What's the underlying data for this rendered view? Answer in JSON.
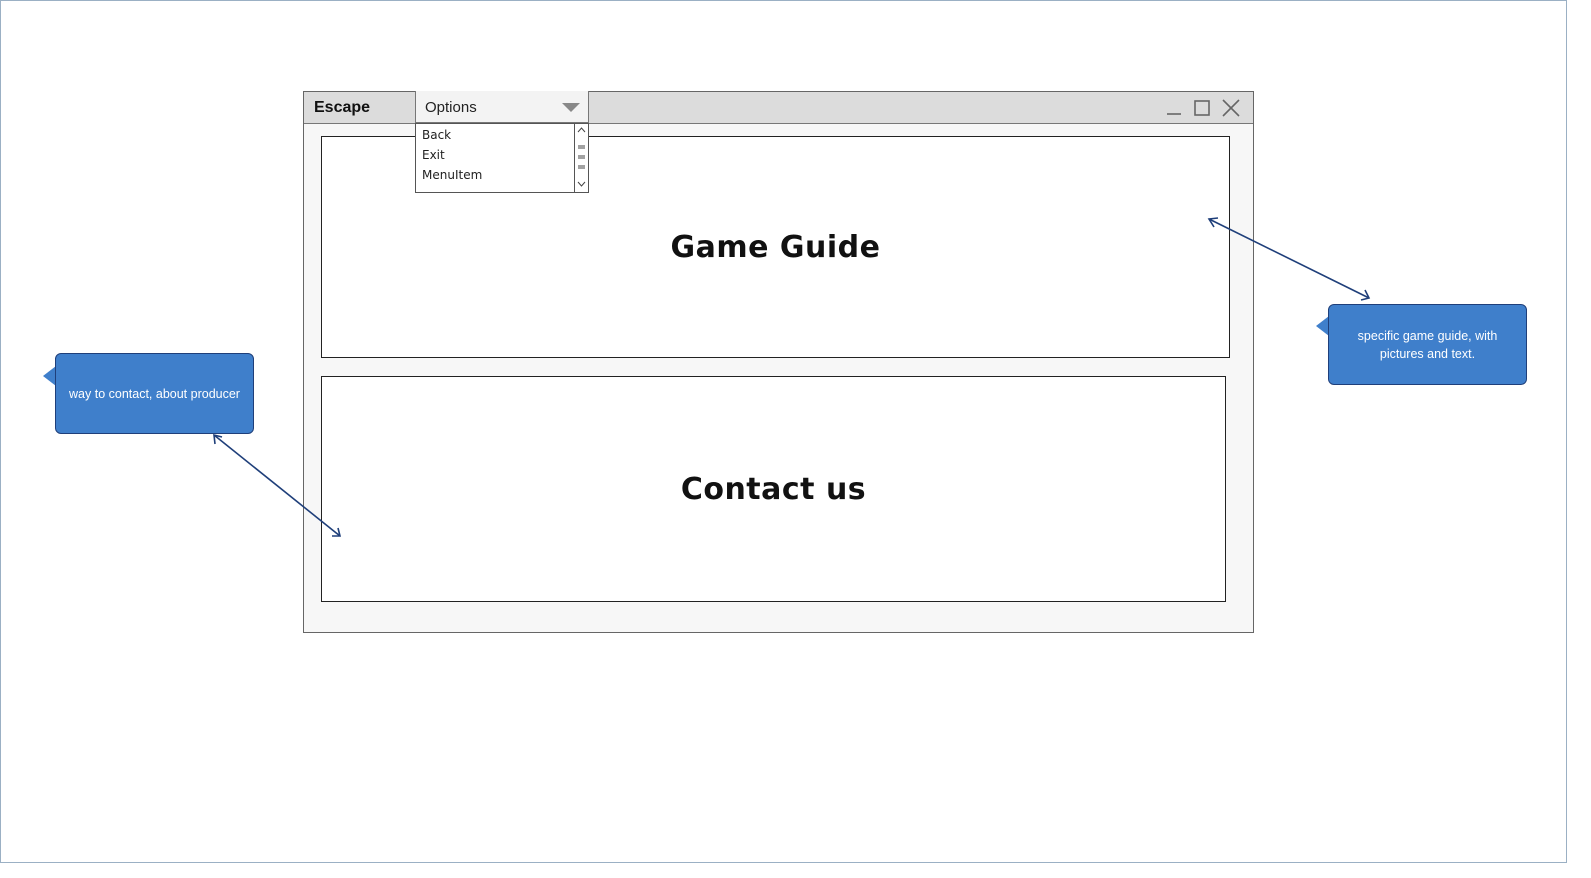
{
  "window": {
    "title": "Escape",
    "options_combo": {
      "selected": "Options",
      "items": [
        "Back",
        "Exit",
        "MenuItem"
      ]
    },
    "controls": [
      "minimize-icon",
      "maximize-icon",
      "close-icon"
    ]
  },
  "panels": {
    "game_guide": "Game Guide",
    "contact_us": "Contact us"
  },
  "annotations": {
    "contact_note": "way to contact, about producer",
    "guide_note": "specific game guide, with pictures and text."
  },
  "colors": {
    "callout_fill": "#3f7fcb",
    "callout_border": "#1f3f7a",
    "connector": "#1f3f7a",
    "titlebar": "#dcdcdc"
  }
}
